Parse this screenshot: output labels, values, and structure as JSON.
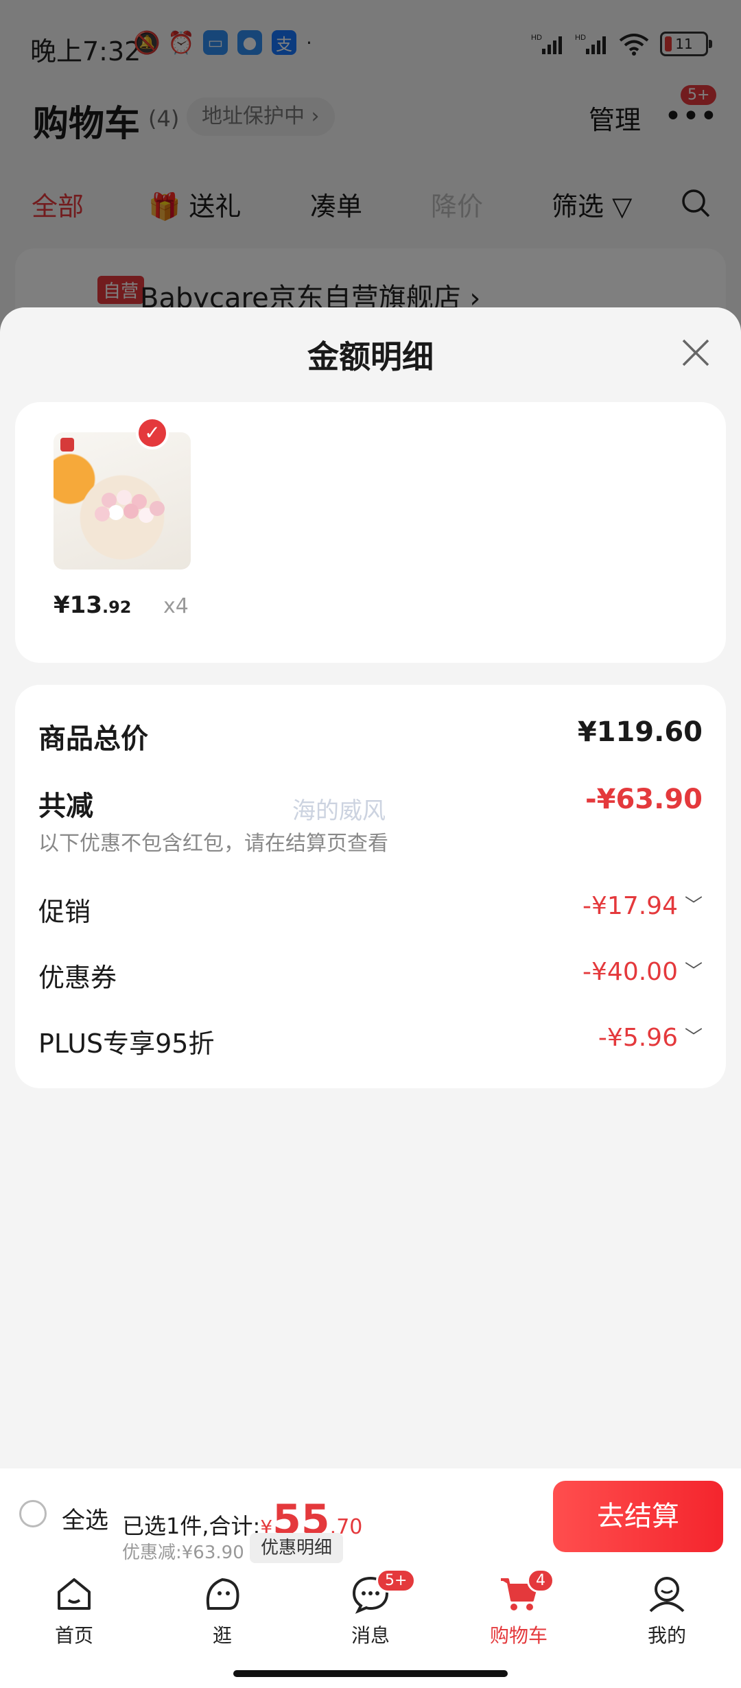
{
  "status_bar": {
    "time": "晚上7:32",
    "battery": "11",
    "app_icon_char": "支"
  },
  "header": {
    "title": "购物车",
    "count": "(4)",
    "address_protect": "地址保护中 ›",
    "manage": "管理",
    "more_badge": "5+"
  },
  "tabs": {
    "all": "全部",
    "gift": "送礼",
    "bundle": "凑单",
    "price_drop": "降价",
    "filter": "筛选"
  },
  "bg_card": {
    "tag": "自营",
    "store": "Babycare京东自营旗舰店 ›"
  },
  "sheet": {
    "title": "金额明细",
    "product": {
      "price_int": "¥13",
      "price_dec": ".92",
      "qty": "x4"
    },
    "total_label": "商品总价",
    "total_value": "¥119.60",
    "reduce_label": "共减",
    "reduce_value": "-¥63.90",
    "watermark": "海的威风",
    "note": "以下优惠不包含红包，请在结算页查看",
    "rows": [
      {
        "label": "促销",
        "value": "-¥17.94"
      },
      {
        "label": "优惠券",
        "value": "-¥40.00"
      },
      {
        "label": "PLUS专享95折",
        "value": "-¥5.96"
      }
    ]
  },
  "checkout": {
    "select_all": "全选",
    "selected_text": "已选1件,合计:",
    "yen": "¥",
    "total_int": "55",
    "total_dec": ".70",
    "discount_text": "优惠减:¥63.90",
    "discount_detail_btn": "优惠明细",
    "pay_btn": "去结算"
  },
  "nav": {
    "home": "首页",
    "browse": "逛",
    "messages": "消息",
    "messages_badge": "5+",
    "cart": "购物车",
    "cart_badge": "4",
    "mine": "我的"
  },
  "colors": {
    "accent": "#e4393c",
    "overlay": "rgba(0,0,0,0.5)"
  }
}
